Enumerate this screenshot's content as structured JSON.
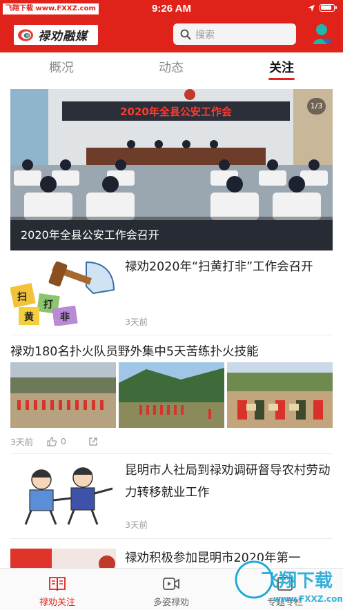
{
  "status": {
    "watermark": "飞翔下载 www.FXXZ.com",
    "time": "9:26 AM"
  },
  "header": {
    "logo_text": "禄劝融媒",
    "search_placeholder": "搜索"
  },
  "tabs": [
    {
      "label": "概况"
    },
    {
      "label": "动态"
    },
    {
      "label": "关注",
      "active": true
    }
  ],
  "hero": {
    "banner_text": "2020年全县公安工作会",
    "caption": "2020年全县公安工作会召开",
    "counter": "1/3"
  },
  "articles": [
    {
      "title": "禄劝2020年“扫黄打非”工作会召开",
      "time": "3天前",
      "stamp_chars": [
        "扫",
        "打",
        "黄",
        "非"
      ]
    },
    {
      "title": "禄劝180名扑火队员野外集中5天苦练扑火技能",
      "time": "3天前",
      "likes": "0"
    },
    {
      "title": "昆明市人社局到禄劝调研督导农村劳动力转移就业工作",
      "time": "3天前"
    },
    {
      "title": "禄劝积极参加昆明市2020年第一"
    }
  ],
  "bottom_nav": [
    {
      "label": "禄劝关注",
      "active": true
    },
    {
      "label": "多姿禄劝"
    },
    {
      "label": "专题专栏"
    }
  ],
  "overlay_watermark": {
    "text": "飞翔下载",
    "url": "www.FXXZ.com"
  },
  "colors": {
    "brand_red": "#e0231a",
    "text": "#222222",
    "muted": "#999999"
  }
}
